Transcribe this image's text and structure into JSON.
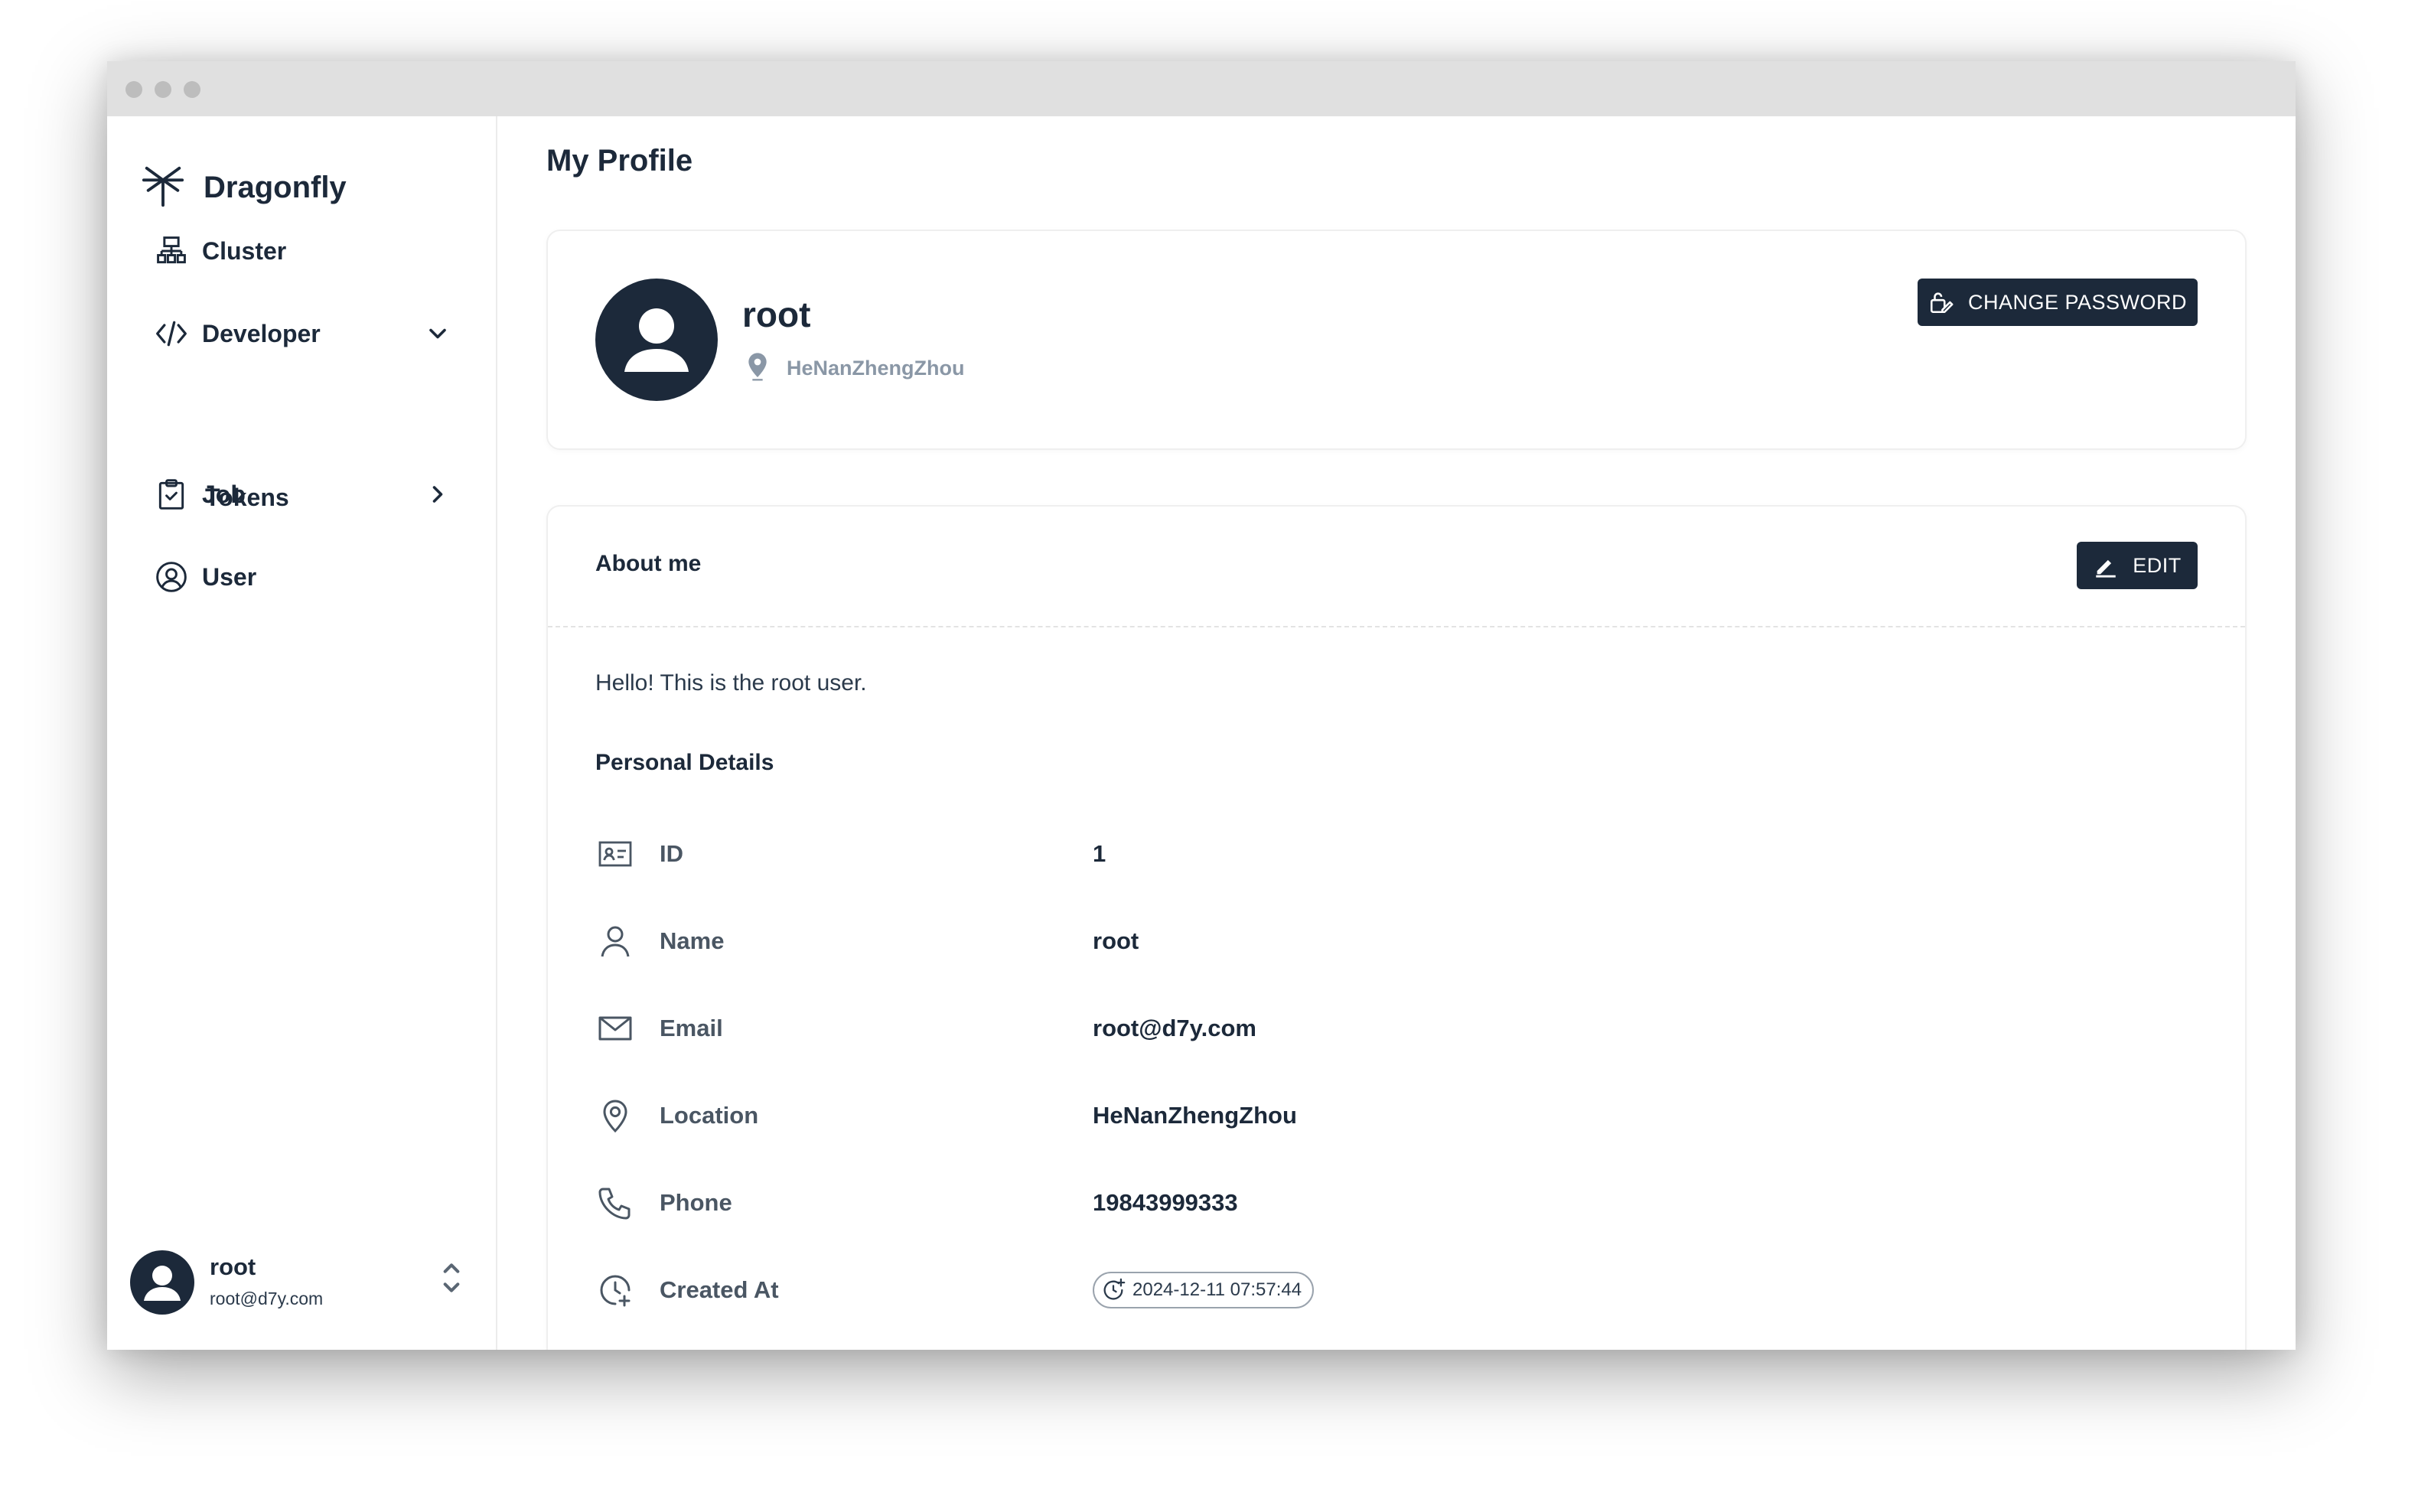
{
  "app": {
    "name": "Dragonfly"
  },
  "sidebar": {
    "items": [
      {
        "label": "Cluster",
        "icon": "cluster-icon"
      },
      {
        "label": "Developer",
        "icon": "code-icon",
        "expanded": true,
        "children": [
          {
            "label": "Tokens"
          }
        ]
      },
      {
        "label": "Job",
        "icon": "clipboard-check-icon",
        "expanded": false
      },
      {
        "label": "User",
        "icon": "user-circle-icon"
      }
    ],
    "current_user": {
      "name": "root",
      "email": "root@d7y.com"
    }
  },
  "page": {
    "title": "My Profile"
  },
  "profile": {
    "name": "root",
    "location": "HeNanZhengZhou",
    "change_password_label": "CHANGE PASSWORD"
  },
  "about": {
    "title": "About me",
    "edit_label": "EDIT",
    "bio": "Hello! This is the root user.",
    "details_title": "Personal Details",
    "details": [
      {
        "icon": "id-card-icon",
        "label": "ID",
        "value": "1"
      },
      {
        "icon": "person-icon",
        "label": "Name",
        "value": "root"
      },
      {
        "icon": "mail-icon",
        "label": "Email",
        "value": "root@d7y.com"
      },
      {
        "icon": "location-icon",
        "label": "Location",
        "value": "HeNanZhengZhou"
      },
      {
        "icon": "phone-icon",
        "label": "Phone",
        "value": "19843999333"
      },
      {
        "icon": "clock-plus-icon",
        "label": "Created At",
        "value": "2024-12-11 07:57:44"
      }
    ]
  },
  "colors": {
    "primary": "#1c293a",
    "muted_text": "#8a97a6",
    "border": "#efefef"
  }
}
